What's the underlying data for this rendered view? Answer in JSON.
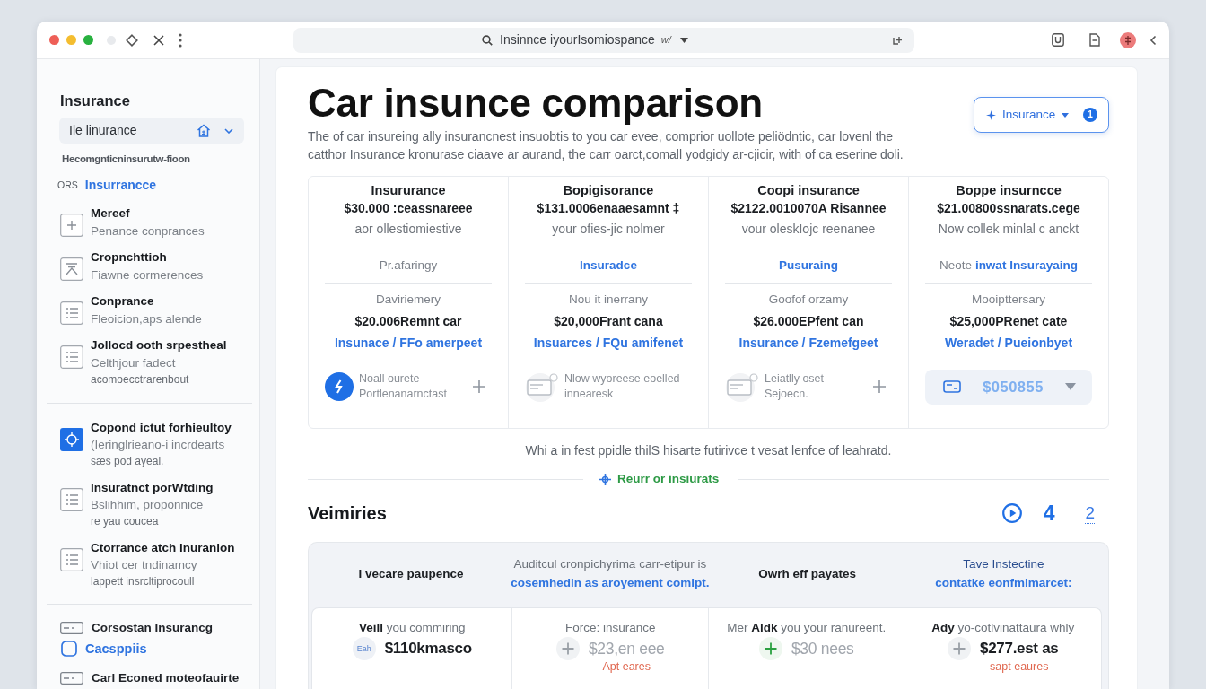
{
  "browser": {
    "address": "Insinnce iyourIsomiospance",
    "address_suffix": "w/"
  },
  "sidebar": {
    "title": "Insurance",
    "select": {
      "value": "Ile linurance"
    },
    "caption": "Hecomgnticninsurutw-fioon",
    "section": {
      "tag": "ORS",
      "label": "Insurrancce"
    },
    "groups": [
      {
        "items": [
          {
            "kind": "plus",
            "title": "Mereef",
            "subtitle": "Penance conprances",
            "selected": false
          },
          {
            "kind": "chart",
            "title": "Cropnchttioh",
            "subtitle": "Fiawne cormerences",
            "selected": false
          },
          {
            "kind": "list",
            "title": "Conprance",
            "subtitle": "Fleoicion,aps alende",
            "selected": false
          },
          {
            "kind": "list",
            "title": "Jollocd ooth srpestheal",
            "subtitle": "Celthjour fadect",
            "note": "acomoecctrarenbout",
            "selected": false
          }
        ]
      },
      {
        "items": [
          {
            "kind": "target",
            "title": "Copond ictut forhieultoy",
            "subtitle": "(Ieringlrieano-i incrdearts",
            "note": "sæs pod ayeal.",
            "selected": true
          },
          {
            "kind": "list",
            "title": "Insuratnct porWtding",
            "subtitle": "Bslihhim, proponnice",
            "note": "re yau coucea",
            "selected": false
          },
          {
            "kind": "list",
            "title": "Ctorrance atch inuranion",
            "subtitle": "Vhiot cer tndinamcy",
            "note": "lappett insrcltiprocoull",
            "selected": false
          }
        ]
      }
    ],
    "links": [
      {
        "kind": "card",
        "label": "Corsostan Insurancg"
      },
      {
        "kind": "link",
        "label": "Cacsppiis"
      },
      {
        "kind": "card",
        "label": "Carl Econed moteofauirte"
      }
    ]
  },
  "main": {
    "title": "Car insunce comparison",
    "filter_button": {
      "label": "Insurance",
      "badge": "1"
    },
    "description": "The of car insureing ally insurancnest insuobtis to you car evee, comprior uollote peliödntic, car lovenl the catthor Insurance kronurase ciaave ar aurand, the carr oarct,comall yodgidy ar-cjicir, with of ca eserine doli.",
    "plans": [
      {
        "title": "Insururance",
        "price": "$30.000 :ceassnareee",
        "subtitle": "aor ollestiomiestive",
        "feature": {
          "text": "Pr.afaringy",
          "link": false
        },
        "label": "Daviriemery",
        "amount": "$20.006Remnt car",
        "link": "Insunace / FFo amerpeet",
        "footer": {
          "kind": "note",
          "active": true,
          "add": true,
          "lines": [
            "Noall ourete",
            "Portlenanarnctast"
          ]
        }
      },
      {
        "title": "Bopigisorance",
        "price": "$131.0006enaaesamnt ‡",
        "subtitle": "your ofies-jic nolmer",
        "feature": {
          "text": "Insuradce",
          "link": true
        },
        "label": "Nou it inerrany",
        "amount": "$20,000Frant cana",
        "link": "Insuarces / FQu amifenet",
        "footer": {
          "kind": "note",
          "active": false,
          "add": false,
          "lines": [
            "Nlow wyoreese eoelled",
            "innearesk"
          ]
        }
      },
      {
        "title": "Coopi insurance",
        "price": "$2122.0010070A Risannee",
        "subtitle": "vour oleskIojc reenanee",
        "feature": {
          "text": "Pusuraing",
          "link": true
        },
        "label": "Goofof orzamy",
        "amount": "$26.000EPfent can",
        "link": "Insurance / Fzemefgeet",
        "footer": {
          "kind": "note",
          "active": false,
          "add": true,
          "lines": [
            "Leiatlly oset",
            "Sejoecn."
          ]
        }
      },
      {
        "title": "Boppe insurncce",
        "price": "$21.00800ssnarats.cege",
        "subtitle": "Now collek minlal c anckt",
        "feature": {
          "prefix": "Neote",
          "text": "inwat Insurayaing",
          "link": true
        },
        "label": "Mooipttersary",
        "amount": "$25,000PRenet cate",
        "link": "Weradet / Pueionbyet",
        "footer": {
          "kind": "select",
          "value": "$050855"
        }
      }
    ],
    "note": "Whi a in fest ppidle thilS hisarte futirivce t vesat lenfce of leahratd.",
    "review_link": "Reurr or insiurats",
    "summary": {
      "title": "Veimiries",
      "pages": [
        {
          "label": "4",
          "selected": true
        },
        {
          "label": "2",
          "selected": false
        }
      ],
      "columns": [
        {
          "lines": [
            {
              "kind": "strong",
              "text": "I vecare paupence"
            }
          ]
        },
        {
          "lines": [
            {
              "kind": "muted",
              "text": "Auditcul cronpichyrima carr-etipur is"
            },
            {
              "kind": "link",
              "text": "cosemhedin as aroyement comipt."
            }
          ]
        },
        {
          "lines": [
            {
              "kind": "strong",
              "text": "Owrh eff payates"
            }
          ]
        },
        {
          "lines": [
            {
              "kind": "accent",
              "text": "Tave Instectine"
            },
            {
              "kind": "link",
              "text": "contatke eonfmimarcet:"
            }
          ]
        }
      ],
      "cells": [
        {
          "caption": "**Veill** you commiring",
          "icon": {
            "kind": "text",
            "label": "Eah"
          },
          "price": "$110kmasco",
          "dim": false
        },
        {
          "caption": "Force: insurance",
          "icon": {
            "kind": "plus"
          },
          "price": "$23,en eee",
          "dim": true,
          "note": "Apt eares"
        },
        {
          "caption": "Mer **Aldk** you your ranureent.",
          "icon": {
            "kind": "plus-accent"
          },
          "price": "$30 nees",
          "dim": true
        },
        {
          "caption": "**Ady** yo-cotlvinattaura whly",
          "icon": {
            "kind": "plus"
          },
          "price": "$277.est as",
          "dim": false,
          "note": "sapt eaures"
        }
      ]
    }
  }
}
